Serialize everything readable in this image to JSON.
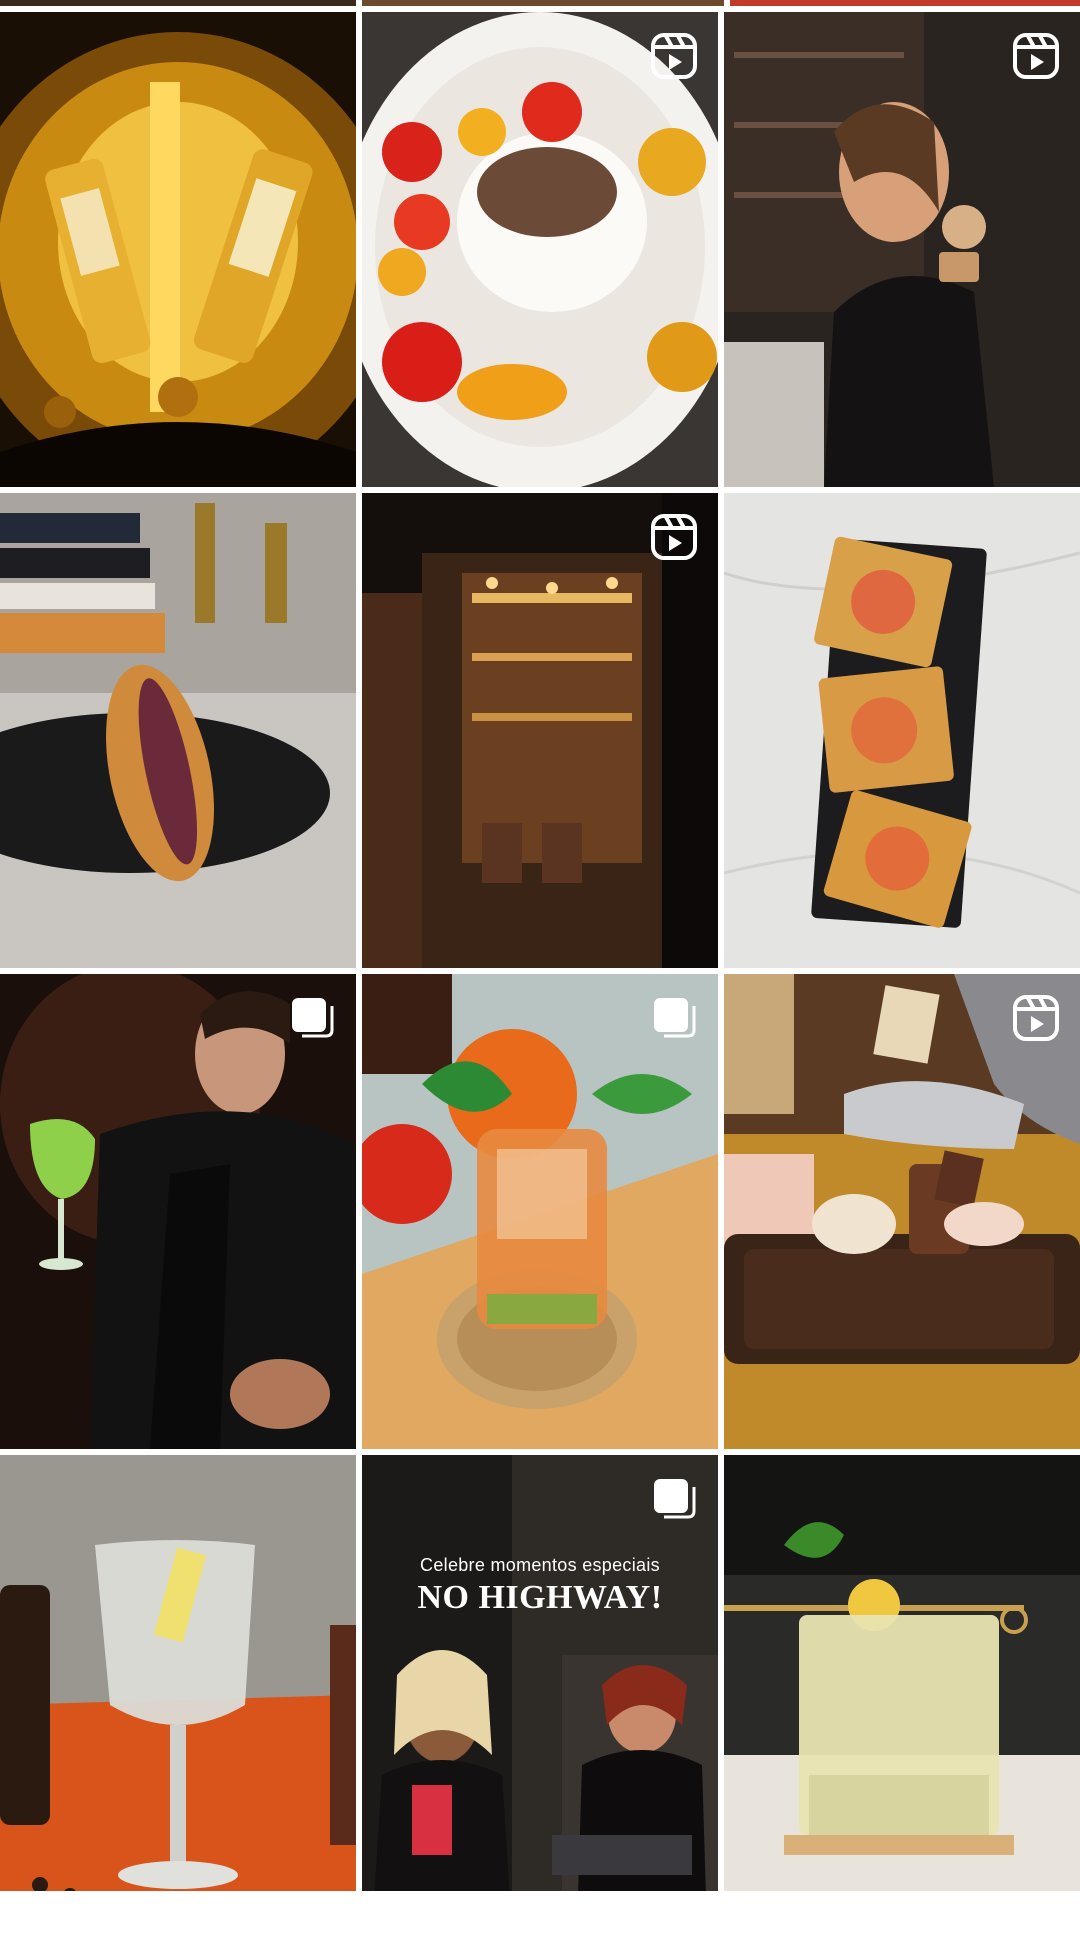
{
  "grid": {
    "tiles": [
      {
        "subject": "whisky-bottles-rack",
        "badge": "none"
      },
      {
        "subject": "burrata-tomatoes-dish",
        "badge": "reel"
      },
      {
        "subject": "woman-with-cocktail",
        "badge": "reel"
      },
      {
        "subject": "hotdog-plate-books",
        "badge": "none"
      },
      {
        "subject": "restaurant-entrance",
        "badge": "reel"
      },
      {
        "subject": "tostadas-slate",
        "badge": "none"
      },
      {
        "subject": "man-green-cocktail",
        "badge": "carousel"
      },
      {
        "subject": "orange-mint-drink",
        "badge": "carousel"
      },
      {
        "subject": "coffee-tray-hands",
        "badge": "reel"
      },
      {
        "subject": "gin-tonic-glass",
        "badge": "none"
      },
      {
        "subject": "highway-promo-women",
        "badge": "carousel"
      },
      {
        "subject": "lemon-cocktail-glass",
        "badge": "none"
      }
    ]
  },
  "promo": {
    "subtitle": "Celebre momentos especiais",
    "title": "NO HIGHWAY!"
  },
  "colors": {
    "reel_icon": "#ffffff",
    "background": "#ffffff"
  }
}
